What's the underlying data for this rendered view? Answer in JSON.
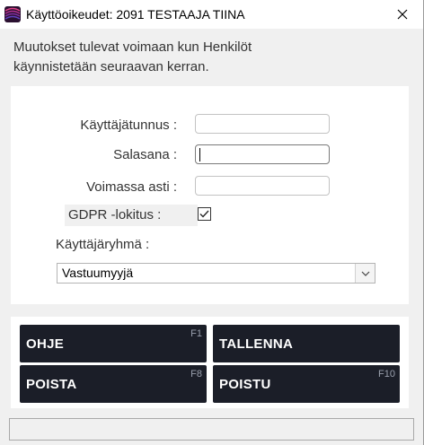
{
  "window": {
    "title": "Käyttöoikeudet: 2091 TESTAAJA TIINA",
    "icon": "app-logo-icon",
    "close_icon": "close-icon"
  },
  "notice": {
    "line1": "Muutokset tulevat voimaan kun Henkilöt",
    "line2": "käynnistetään seuraavan kerran."
  },
  "form": {
    "username_label": "Käyttäjätunnus :",
    "username_value": "",
    "password_label": "Salasana :",
    "password_value": "",
    "valid_until_label": "Voimassa asti :",
    "valid_until_value": "",
    "gdpr_label": "GDPR -lokitus :",
    "gdpr_checked": true,
    "group_label": "Käyttäjäryhmä :",
    "group_value": "Vastuumyyjä"
  },
  "buttons": [
    {
      "label": "OHJE",
      "key": "F1"
    },
    {
      "label": "TALLENNA",
      "key": ""
    },
    {
      "label": "POISTA",
      "key": "F8"
    },
    {
      "label": "POISTU",
      "key": "F10"
    }
  ],
  "colors": {
    "button_bg": "#1b1e28",
    "button_text": "#ffffff",
    "panel_bg": "#ffffff",
    "window_bg": "#f0f0f0"
  }
}
